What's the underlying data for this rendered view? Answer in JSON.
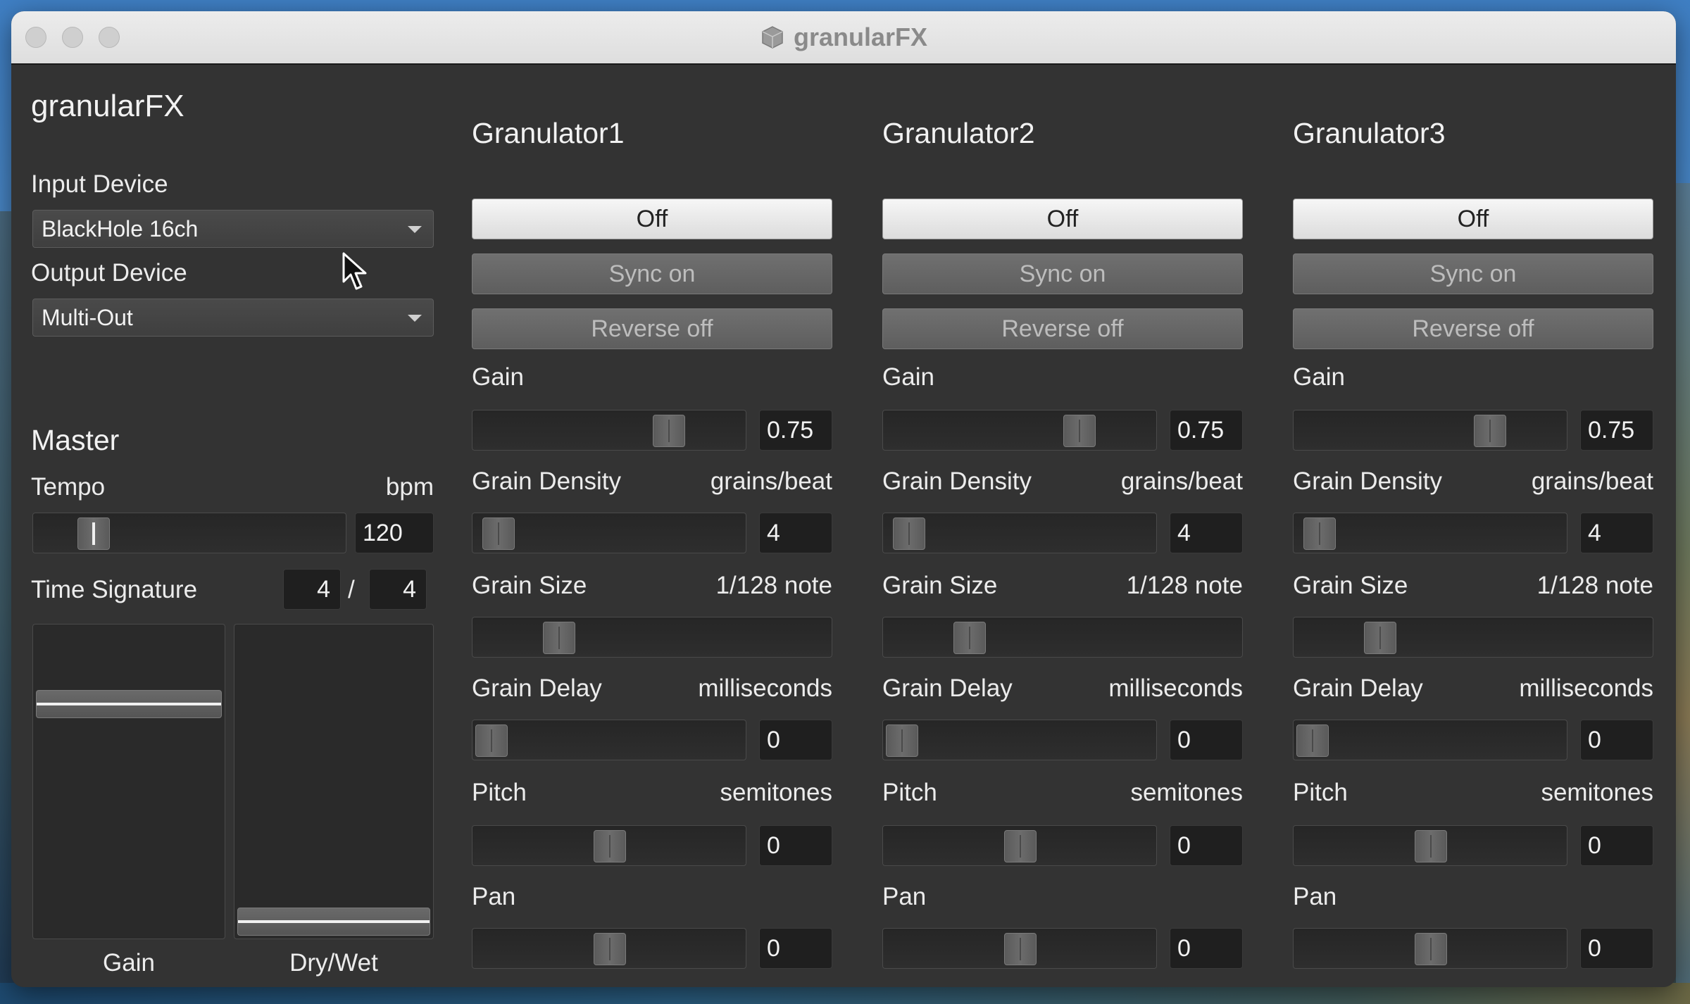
{
  "window": {
    "title": "granularFX",
    "icon": "cube-app-icon"
  },
  "left": {
    "app_title": "granularFX",
    "input_label": "Input Device",
    "input_value": "BlackHole 16ch",
    "output_label": "Output Device",
    "output_value": "Multi-Out",
    "master_heading": "Master",
    "tempo_label": "Tempo",
    "tempo_unit": "bpm",
    "tempo_value": "120",
    "tempo_slider_fraction": 0.15,
    "timesig_label": "Time Signature",
    "timesig_num": "4",
    "timesig_sep": "/",
    "timesig_den": "4",
    "gain_label": "Gain",
    "gain_fader_fraction": 0.78,
    "drywet_label": "Dry/Wet",
    "drywet_fader_fraction": 0.0
  },
  "granulators": [
    {
      "title": "Granulator1",
      "off_label": "Off",
      "sync_label": "Sync on",
      "reverse_label": "Reverse off",
      "gain": {
        "label": "Gain",
        "unit": "",
        "value": "0.75",
        "fraction": 0.75
      },
      "density": {
        "label": "Grain Density",
        "unit": "grains/beat",
        "value": "4",
        "fraction": 0.03
      },
      "size": {
        "label": "Grain Size",
        "unit": "1/128 note",
        "fraction": 0.21
      },
      "delay": {
        "label": "Grain Delay",
        "unit": "milliseconds",
        "value": "0",
        "fraction": 0.0
      },
      "pitch": {
        "label": "Pitch",
        "unit": "semitones",
        "value": "0",
        "fraction": 0.5
      },
      "pan": {
        "label": "Pan",
        "unit": "",
        "value": "0",
        "fraction": 0.5
      }
    },
    {
      "title": "Granulator2",
      "off_label": "Off",
      "sync_label": "Sync on",
      "reverse_label": "Reverse off",
      "gain": {
        "label": "Gain",
        "unit": "",
        "value": "0.75",
        "fraction": 0.75
      },
      "density": {
        "label": "Grain Density",
        "unit": "grains/beat",
        "value": "4",
        "fraction": 0.03
      },
      "size": {
        "label": "Grain Size",
        "unit": "1/128 note",
        "fraction": 0.21
      },
      "delay": {
        "label": "Grain Delay",
        "unit": "milliseconds",
        "value": "0",
        "fraction": 0.0
      },
      "pitch": {
        "label": "Pitch",
        "unit": "semitones",
        "value": "0",
        "fraction": 0.5
      },
      "pan": {
        "label": "Pan",
        "unit": "",
        "value": "0",
        "fraction": 0.5
      }
    },
    {
      "title": "Granulator3",
      "off_label": "Off",
      "sync_label": "Sync on",
      "reverse_label": "Reverse off",
      "gain": {
        "label": "Gain",
        "unit": "",
        "value": "0.75",
        "fraction": 0.75
      },
      "density": {
        "label": "Grain Density",
        "unit": "grains/beat",
        "value": "4",
        "fraction": 0.03
      },
      "size": {
        "label": "Grain Size",
        "unit": "1/128 note",
        "fraction": 0.21
      },
      "delay": {
        "label": "Grain Delay",
        "unit": "milliseconds",
        "value": "0",
        "fraction": 0.0
      },
      "pitch": {
        "label": "Pitch",
        "unit": "semitones",
        "value": "0",
        "fraction": 0.5
      },
      "pan": {
        "label": "Pan",
        "unit": "",
        "value": "0",
        "fraction": 0.5
      }
    }
  ]
}
